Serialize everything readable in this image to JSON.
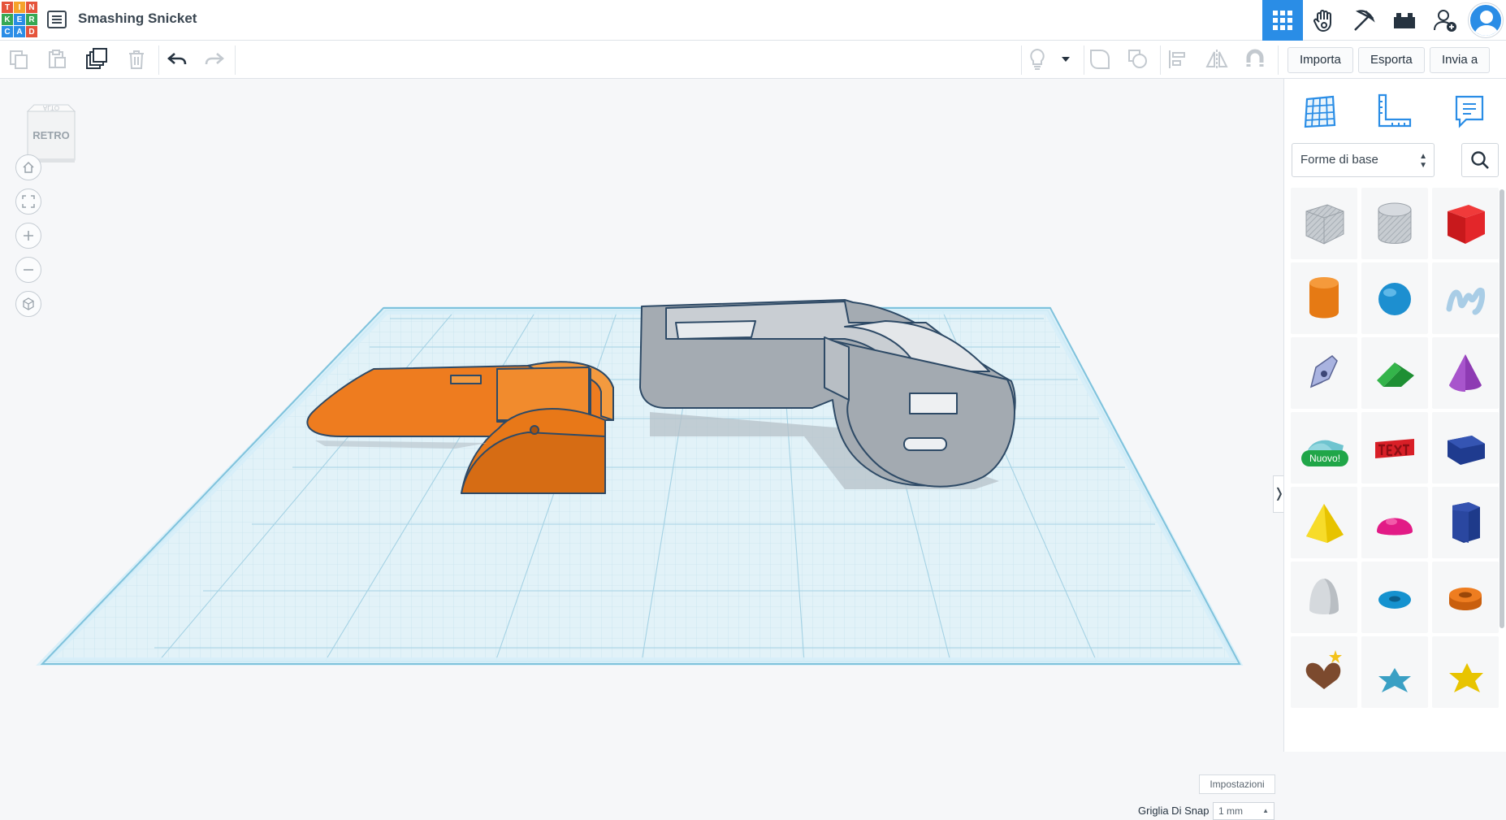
{
  "app": {
    "logo_letters": [
      "T",
      "I",
      "N",
      "K",
      "E",
      "R",
      "C",
      "A",
      "D"
    ],
    "logo_colors": [
      "#e5543b",
      "#f6a32a",
      "#e5543b",
      "#36a853",
      "#2a8de6",
      "#36a853",
      "#2a8de6",
      "#2a8de6",
      "#e5543b"
    ],
    "document_title": "Smashing Snicket"
  },
  "top_nav": {
    "items": [
      "grid-view-icon",
      "tinker-hand-icon",
      "pickaxe-icon",
      "bricks-icon",
      "add-user-icon",
      "profile-avatar-icon"
    ],
    "active": "grid-view-icon",
    "accent_color": "#2a8de6"
  },
  "toolbar": {
    "import_label": "Importa",
    "export_label": "Esporta",
    "send_label": "Invia a"
  },
  "viewport": {
    "view_cube_label": "RETRO",
    "view_cube_top_label": "ALTO",
    "settings_label": "Impostazioni",
    "snap_label": "Griglia Di Snap",
    "snap_value": "1 mm",
    "collapse_glyph": "❭",
    "workplane_color": "#cfeaf6",
    "shape_colors": {
      "orange_part": "#ee7a1c",
      "gray_part": "#a7adb4"
    }
  },
  "panel": {
    "category_value": "Forme di base",
    "category_arrows": "▲▼",
    "new_badge_label": "Nuovo!",
    "shapes": [
      "box-hole",
      "cylinder-hole",
      "box",
      "cylinder",
      "sphere",
      "scribble",
      "shape-generator",
      "roof",
      "cone",
      "round-roof",
      "text",
      "polygon",
      "pyramid",
      "half-sphere",
      "hexagonal-prism",
      "paraboloid",
      "torus",
      "tube",
      "heart",
      "star",
      "star-gold"
    ]
  }
}
